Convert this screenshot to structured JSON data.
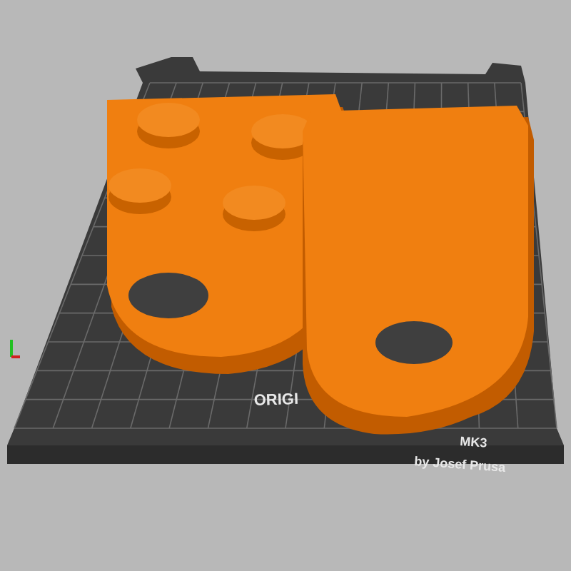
{
  "viewport": {
    "bed_labels": [
      {
        "text": "ORIGI"
      },
      {
        "text": "MK3"
      },
      {
        "text": "by Josef Prusa"
      }
    ]
  }
}
